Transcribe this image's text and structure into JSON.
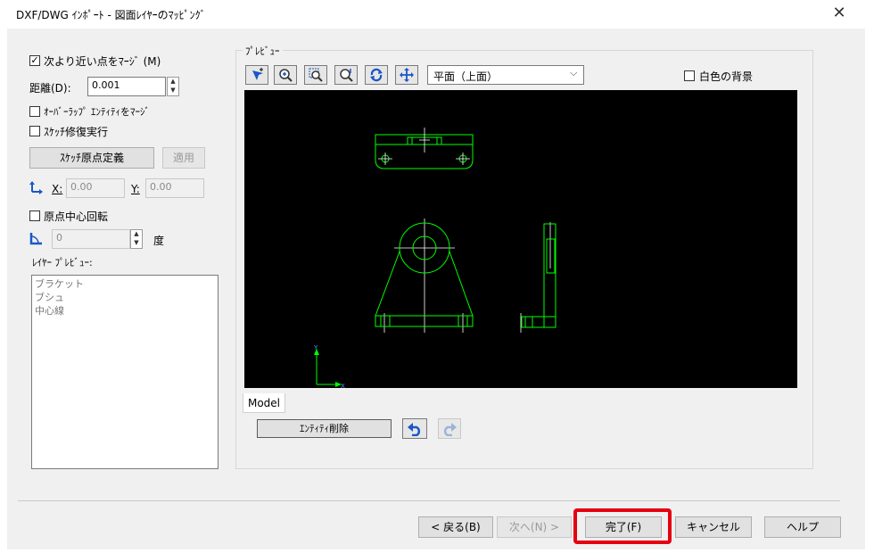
{
  "window": {
    "title": "DXF/DWG ｲﾝﾎﾟｰﾄ - 図面ﾚｲﾔｰのﾏｯﾋﾟﾝｸﾞ",
    "close_glyph": "✕"
  },
  "options": {
    "merge_label": "次より近い点をﾏｰｼﾞ (M)",
    "merge_checked": true,
    "distance_label": "距離(D):",
    "distance_value": "0.001",
    "overlap_label": "ｵｰﾊﾞｰﾗｯﾌﾟ ｴﾝﾃｨﾃｨをﾏｰｼﾞ",
    "sketch_repair_label": "ｽｹｯﾁ修復実行",
    "sketch_origin_button": "ｽｹｯﾁ原点定義",
    "apply_button": "適用",
    "x_label": "X:",
    "x_value": "0.00",
    "y_label": "Y:",
    "y_value": "0.00",
    "rotate_label": "原点中心回転",
    "rotate_value": "0",
    "degree_label": "度",
    "layer_preview_label": "ﾚｲﾔｰ ﾌﾟﾚﾋﾞｭｰ:",
    "layers": [
      "ブラケット",
      "ブシュ",
      "中心線"
    ]
  },
  "preview": {
    "group_label": "ﾌﾟﾚﾋﾞｭｰ",
    "view_select": "平面（上面）",
    "white_bg_label": "白色の背景",
    "tab_label": "Model",
    "delete_entity_button": "ｴﾝﾃｨﾃｨ削除",
    "tools": [
      "select-filter-icon",
      "zoom-in-icon",
      "zoom-fit-icon",
      "zoom-area-icon",
      "rotate-icon",
      "pan-icon"
    ]
  },
  "footer": {
    "back_button": "< 戻る(B)",
    "next_button": "次へ(N) >",
    "finish_button": "完了(F)",
    "cancel_button": "キャンセル",
    "help_button": "ヘルプ"
  },
  "colors": {
    "accent_highlight": "#e60012",
    "drawing": "#00ff00",
    "axis_y": "#3aa0ff",
    "canvas": "#000000"
  }
}
